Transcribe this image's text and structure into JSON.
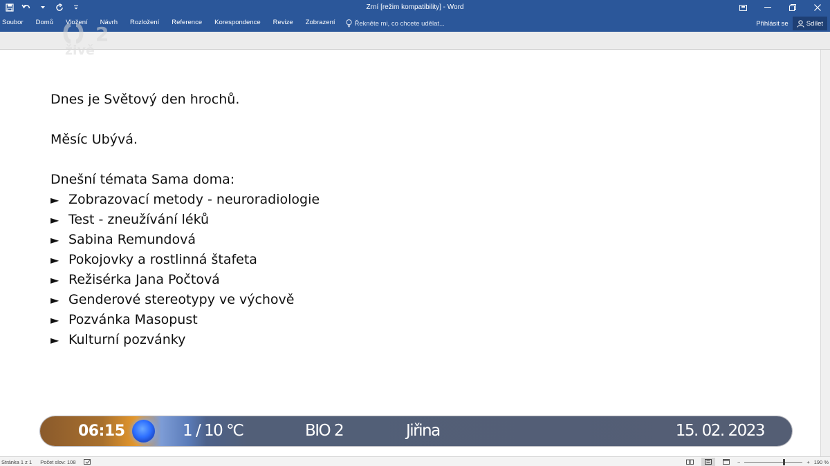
{
  "window": {
    "title": "Zrní [režim kompatibility] - Word"
  },
  "quick_access": {
    "icons": [
      "save-icon",
      "undo-icon",
      "redo-icon",
      "customize-icon"
    ]
  },
  "ribbon": {
    "tabs": [
      "Soubor",
      "Domů",
      "Vložení",
      "Návrh",
      "Rozložení",
      "Reference",
      "Korespondence",
      "Revize",
      "Zobrazení"
    ],
    "tell_me": "Řekněte mi, co chcete udělat...",
    "sign_in": "Přihlásit se",
    "share": "Sdílet"
  },
  "watermark": {
    "channel_number": "2",
    "text": "živě"
  },
  "document": {
    "line1": "Dnes je Světový den hrochů.",
    "line2": "Měsíc Ubývá.",
    "line3": "Dnešní témata Sama doma:",
    "bullet_symbol": "►",
    "topics": [
      "Zobrazovací metody - neuroradiologie",
      "Test - zneužívání léků",
      "Sabina Remundová",
      "Pokojovky a rostlinná štafeta",
      "Režisérka Jana Počtová",
      "Genderové stereotypy ve výchově",
      "Pozvánka Masopust",
      "Kulturní pozvánky"
    ]
  },
  "tv_bar": {
    "time": "06:15",
    "weather": "1 / 10 ℃",
    "station": "BIO 2",
    "name": "Jiřina",
    "date": "15. 02. 2023"
  },
  "status_bar": {
    "page": "Stránka 1 z 1",
    "word_count": "Počet slov: 108",
    "zoom_minus": "−",
    "zoom_plus": "+",
    "zoom": "190 %",
    "zoom_level_fraction": 0.67
  },
  "colors": {
    "ribbon_blue": "#2b579a",
    "tv_bar_slate": "#545e74",
    "tv_bar_orange": "#e89a2c"
  }
}
